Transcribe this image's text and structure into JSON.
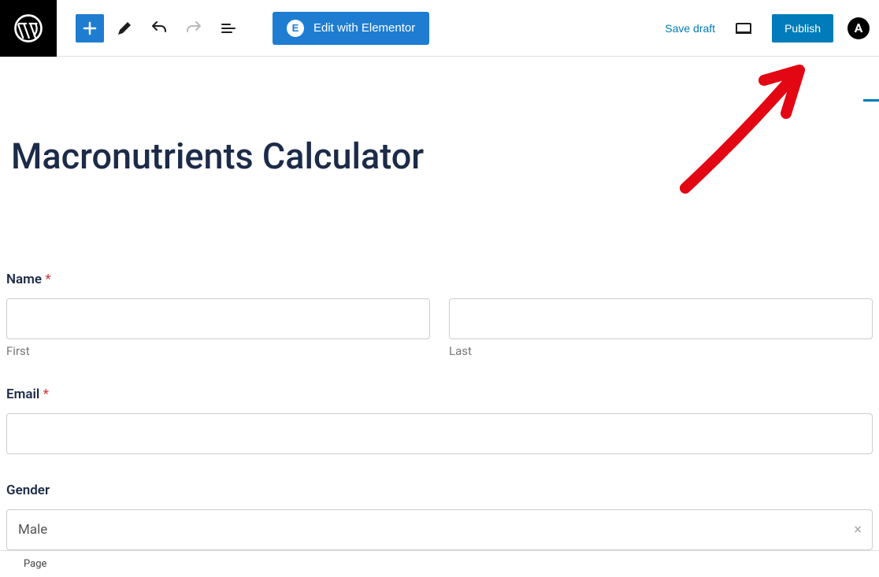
{
  "toolbar": {
    "elementor_label": "Edit with Elementor",
    "save_draft_label": "Save draft",
    "publish_label": "Publish"
  },
  "page": {
    "title": "Macronutrients Calculator"
  },
  "form": {
    "name": {
      "label": "Name",
      "required_mark": "*",
      "first_label": "First",
      "last_label": "Last"
    },
    "email": {
      "label": "Email",
      "required_mark": "*"
    },
    "gender": {
      "label": "Gender",
      "selected": "Male"
    }
  },
  "footer": {
    "breadcrumb": "Page"
  },
  "icons": {
    "elementor_badge": "E",
    "theme_badge": "A",
    "clear_mark": "×"
  }
}
